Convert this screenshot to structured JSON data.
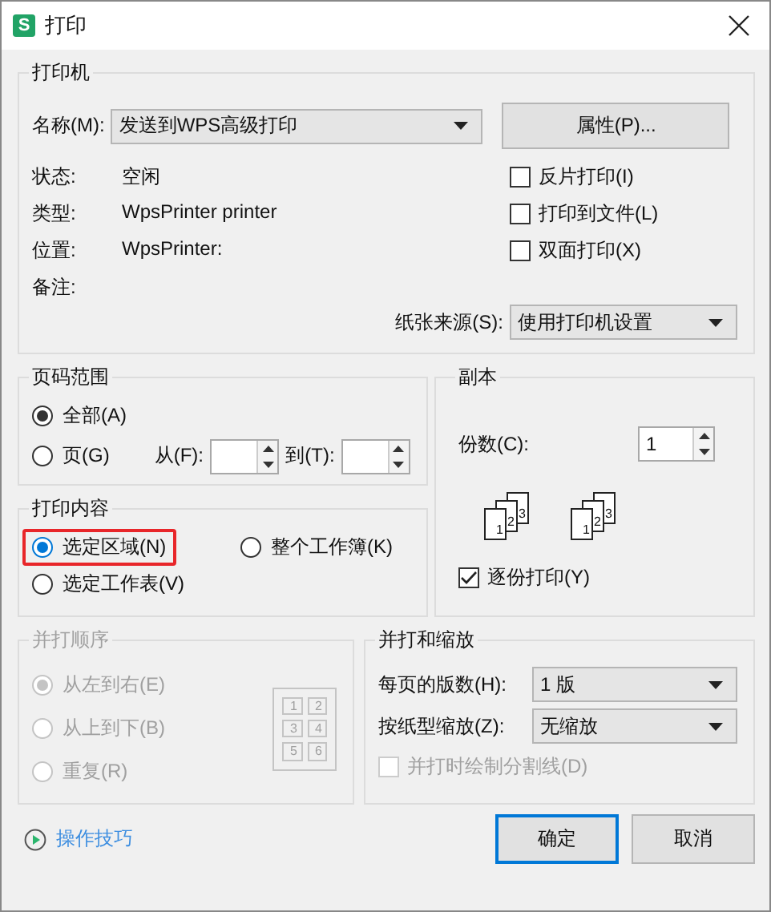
{
  "window": {
    "title": "打印",
    "icon_letter": "S"
  },
  "printer": {
    "legend": "打印机",
    "name_label": "名称(M):",
    "name_value": "发送到WPS高级打印",
    "properties_button": "属性(P)...",
    "info": [
      {
        "label": "状态:",
        "value": "空闲"
      },
      {
        "label": "类型:",
        "value": "WpsPrinter printer"
      },
      {
        "label": "位置:",
        "value": "WpsPrinter:"
      },
      {
        "label": "备注:"
      }
    ],
    "options": [
      {
        "label": "反片打印(I)",
        "checked": false
      },
      {
        "label": "打印到文件(L)",
        "checked": false
      },
      {
        "label": "双面打印(X)",
        "checked": false
      }
    ],
    "paper_source": {
      "label": "纸张来源(S):",
      "value": "使用打印机设置"
    }
  },
  "page_range": {
    "legend": "页码范围",
    "options": [
      {
        "label": "全部(A)",
        "selected": true
      },
      {
        "label": "页(G)",
        "selected": false
      }
    ],
    "from_label": "从(F):",
    "to_label": "到(T):"
  },
  "copies": {
    "legend": "副本",
    "count_label": "份数(C):",
    "count_value": "1",
    "collate_icons": [
      [
        "1",
        "2",
        "3"
      ],
      [
        "1",
        "2",
        "3"
      ]
    ],
    "collate": {
      "label": "逐份打印(Y)",
      "checked": true
    }
  },
  "print_content": {
    "legend": "打印内容",
    "options": [
      {
        "label": "选定区域(N)",
        "selected": true,
        "highlighted": true
      },
      {
        "label": "整个工作簿(K)",
        "selected": false,
        "highlighted": false
      },
      {
        "label": "选定工作表(V)",
        "selected": false,
        "highlighted": false
      }
    ]
  },
  "page_order": {
    "legend": "并打顺序",
    "disabled": true,
    "options": [
      {
        "label": "从左到右(E)",
        "selected": true
      },
      {
        "label": "从上到下(B)",
        "selected": false
      },
      {
        "label": "重复(R)",
        "selected": false
      }
    ],
    "preview": [
      "1",
      "2",
      "3",
      "4",
      "5",
      "6"
    ]
  },
  "scaling": {
    "legend": "并打和缩放",
    "pages_per_sheet": {
      "label": "每页的版数(H):",
      "value": "1 版"
    },
    "scale_to_paper": {
      "label": "按纸型缩放(Z):",
      "value": "无缩放"
    },
    "draw_borders": {
      "label": "并打时绘制分割线(D)",
      "checked": false,
      "disabled": true
    }
  },
  "footer": {
    "tips_link": "操作技巧",
    "buttons": [
      {
        "label": "确定",
        "default": true
      },
      {
        "label": "取消",
        "default": false
      }
    ]
  }
}
